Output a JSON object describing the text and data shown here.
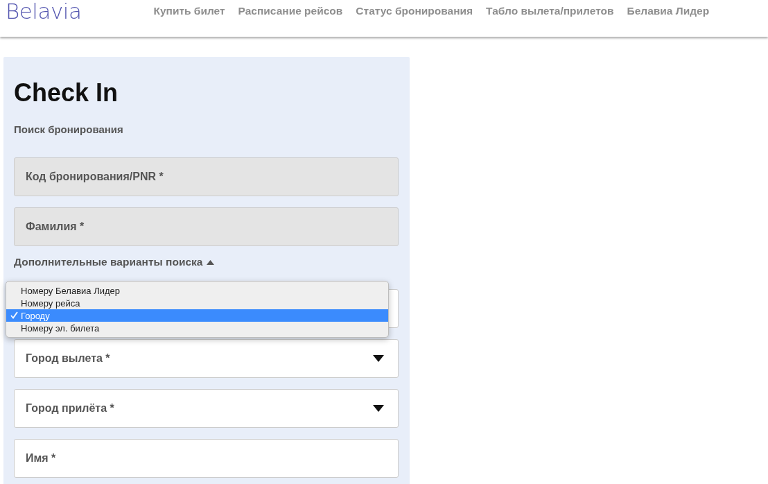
{
  "header": {
    "logo": "Belavia",
    "nav": [
      {
        "label": "Купить билет"
      },
      {
        "label": "Расписание рейсов"
      },
      {
        "label": "Статус бронирования"
      },
      {
        "label": "Табло вылета/прилетов"
      },
      {
        "label": "Белавиа Лидер"
      }
    ]
  },
  "form": {
    "title": "Check In",
    "subtitle": "Поиск бронирования",
    "fields": [
      {
        "kind": "filled",
        "placeholder": "Код бронирования/PNR *"
      },
      {
        "kind": "filled",
        "placeholder": "Фамилия *"
      }
    ],
    "more_options": {
      "label": "Дополнительные варианты поиска",
      "expanded": true
    },
    "search_by": {
      "options": [
        {
          "label": "Номеру Белавиа Лидер",
          "selected": false
        },
        {
          "label": "Номеру рейса",
          "selected": false
        },
        {
          "label": "Городу",
          "selected": true
        },
        {
          "label": "Номеру эл. билета",
          "selected": false
        }
      ]
    },
    "extra_fields": [
      {
        "kind": "select",
        "placeholder": "Город вылета *"
      },
      {
        "kind": "select",
        "placeholder": "Город прилёта *"
      },
      {
        "kind": "text",
        "placeholder": "Имя *"
      }
    ]
  }
}
